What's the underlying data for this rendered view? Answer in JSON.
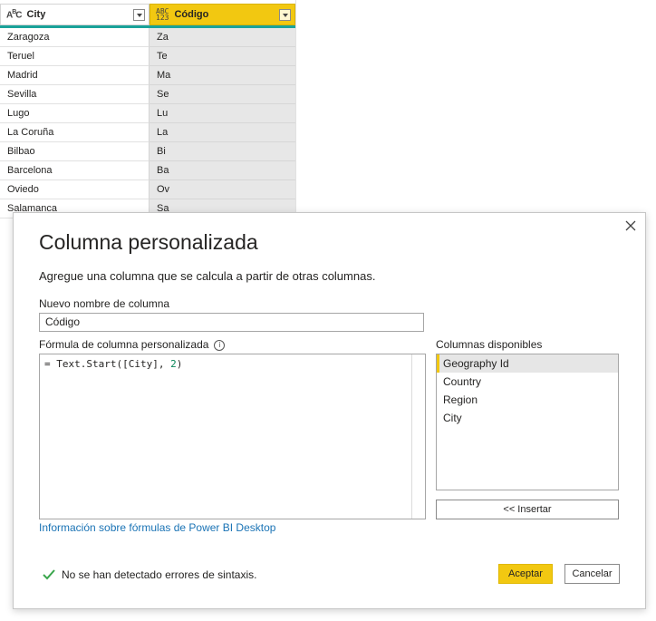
{
  "grid": {
    "columns": [
      {
        "name": "City",
        "type_icon": "text-type-icon"
      },
      {
        "name": "Código",
        "type_icon": "any-type-icon"
      }
    ],
    "rows": [
      {
        "city": "Zaragoza",
        "code": "Za"
      },
      {
        "city": "Teruel",
        "code": "Te"
      },
      {
        "city": "Madrid",
        "code": "Ma"
      },
      {
        "city": "Sevilla",
        "code": "Se"
      },
      {
        "city": "Lugo",
        "code": "Lu"
      },
      {
        "city": "La Coruña",
        "code": "La"
      },
      {
        "city": "Bilbao",
        "code": "Bi"
      },
      {
        "city": "Barcelona",
        "code": "Ba"
      },
      {
        "city": "Oviedo",
        "code": "Ov"
      },
      {
        "city": "Salamanca",
        "code": "Sa"
      }
    ],
    "accent_header": "#f2c811",
    "accent_bar": "#1aa29a"
  },
  "dialog": {
    "title": "Columna personalizada",
    "subtitle": "Agregue una columna que se calcula a partir de otras columnas.",
    "name_label": "Nuevo nombre de columna",
    "name_value": "Código",
    "formula_label": "Fórmula de columna personalizada",
    "formula_prefix": "= Text.Start([City], ",
    "formula_number": "2",
    "formula_suffix": ")",
    "columns_label": "Columnas disponibles",
    "available_columns": [
      "Geography Id",
      "Country",
      "Region",
      "City"
    ],
    "selected_column": "Geography Id",
    "insert_label": "<< Insertar",
    "help_link": "Información sobre fórmulas de Power BI Desktop",
    "status_text": "No se han detectado errores de sintaxis.",
    "ok_label": "Aceptar",
    "cancel_label": "Cancelar",
    "colors": {
      "primary": "#f2c811",
      "link": "#1a73b5",
      "success": "#3aa64c"
    }
  }
}
